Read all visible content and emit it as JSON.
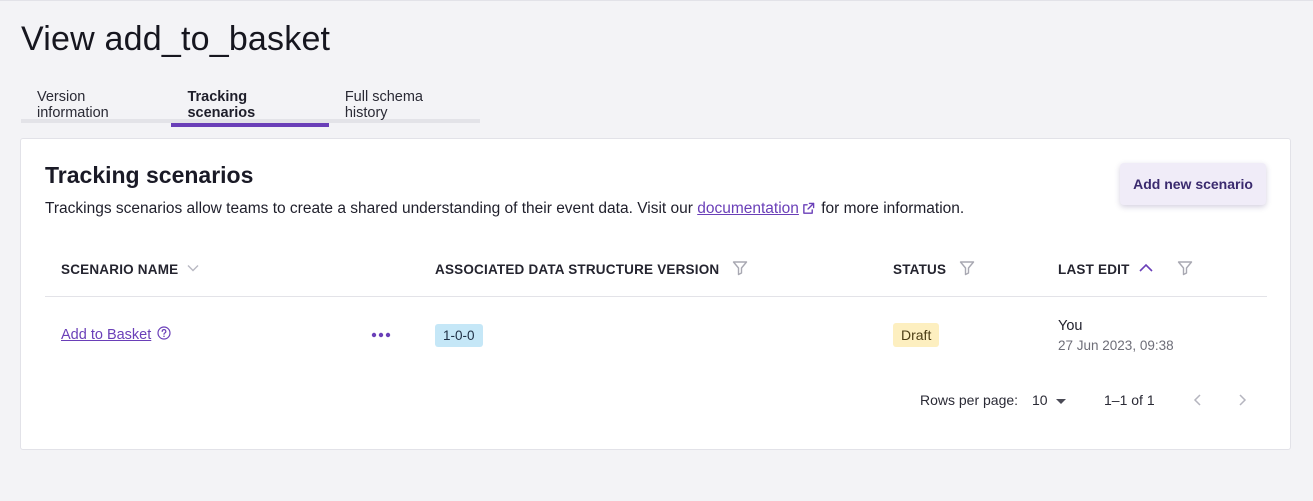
{
  "page": {
    "title": "View add_to_basket"
  },
  "tabs": [
    {
      "label": "Version information"
    },
    {
      "label": "Tracking scenarios"
    },
    {
      "label": "Full schema history"
    }
  ],
  "card": {
    "title": "Tracking scenarios",
    "description_before": "Trackings scenarios allow teams to create a shared understanding of their event data. Visit our",
    "doc_link": "documentation",
    "description_after": "for more information.",
    "add_button": "Add new scenario"
  },
  "table": {
    "headers": {
      "name": "SCENARIO NAME",
      "version": "ASSOCIATED DATA STRUCTURE VERSION",
      "status": "STATUS",
      "last_edit": "LAST EDIT"
    },
    "rows": [
      {
        "name": "Add to Basket",
        "version": "1-0-0",
        "status": "Draft",
        "edited_by": "You",
        "edited_at": "27 Jun 2023, 09:38"
      }
    ]
  },
  "pagination": {
    "rows_per_page_label": "Rows per page:",
    "rows_per_page_value": "10",
    "range": "1–1 of 1"
  },
  "colors": {
    "accent": "#6a3fb8",
    "version_tag": "#c5e7f7",
    "status_draft": "#fdefc0"
  }
}
